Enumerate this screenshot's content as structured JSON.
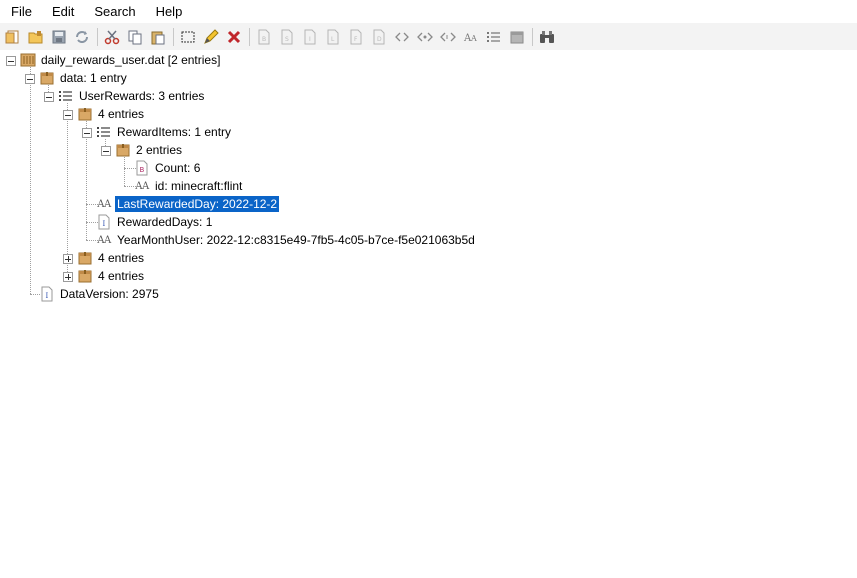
{
  "menu": {
    "file": "File",
    "edit": "Edit",
    "search": "Search",
    "help": "Help"
  },
  "toolbar": {
    "icons": [
      "open-file-icon",
      "open-folder-icon",
      "save-icon",
      "refresh-icon",
      "cut-icon",
      "copy-icon",
      "paste-icon",
      "rename-icon",
      "edit-icon",
      "delete-icon",
      "add-byte-icon",
      "add-short-icon",
      "add-int-icon",
      "add-long-icon",
      "add-float-icon",
      "add-double-icon",
      "add-byte-array-icon",
      "add-int-array-icon",
      "add-long-array-icon",
      "add-string-icon",
      "add-list-icon",
      "add-compound-icon",
      "find-icon"
    ]
  },
  "tree": {
    "root": "daily_rewards_user.dat [2 entries]",
    "data": "data: 1 entry",
    "user_rewards": "UserRewards: 3 entries",
    "entry1": "4 entries",
    "reward_items": "RewardItems: 1 entry",
    "item_compound": "2 entries",
    "count": "Count: 6",
    "id": "id: minecraft:flint",
    "last_rewarded_day": "LastRewardedDay: 2022-12-2",
    "rewarded_days": "RewardedDays: 1",
    "year_month_user": "YearMonthUser: 2022-12:c8315e49-7fb5-4c05-b7ce-f5e021063b5d",
    "entry2": "4 entries",
    "entry3": "4 entries",
    "data_version": "DataVersion: 2975"
  },
  "colors": {
    "selection": "#0a64c8",
    "toolbar_bg": "#f3f3f3",
    "folder_tan": "#d9a866"
  }
}
